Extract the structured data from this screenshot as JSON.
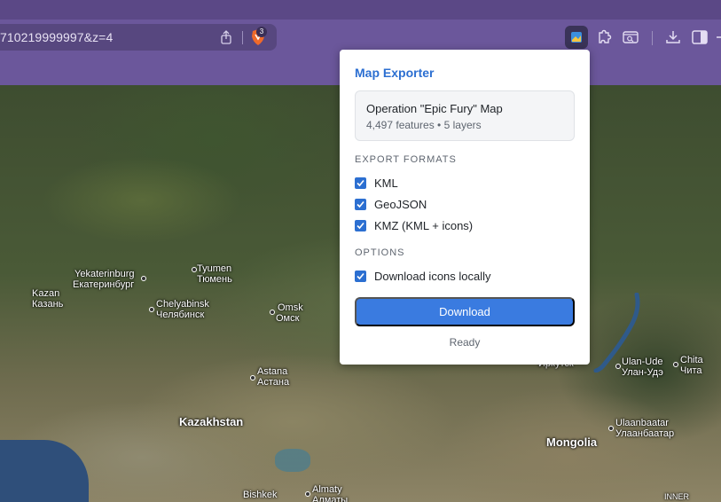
{
  "browser": {
    "url": "710219999997&z=4",
    "brave_badge_count": "3",
    "icons": [
      "share-icon",
      "brave-shields-icon",
      "map-exporter-extension-icon",
      "extensions-puzzle-icon",
      "reader-mode-icon",
      "download-icon",
      "sidebar-toggle-icon"
    ],
    "colors": {
      "tabbar": "#5b4886",
      "toolbar": "#6b579b",
      "urlbar": "#57477f"
    }
  },
  "popup": {
    "title": "Map Exporter",
    "map_name": "Operation \"Epic Fury\" Map",
    "map_stats": "4,497 features • 5 layers",
    "export_formats_label": "EXPORT FORMATS",
    "formats": [
      {
        "label": "KML",
        "checked": true
      },
      {
        "label": "GeoJSON",
        "checked": true
      },
      {
        "label": "KMZ (KML + icons)",
        "checked": true
      }
    ],
    "options_label": "OPTIONS",
    "options": [
      {
        "label": "Download icons locally",
        "checked": true
      }
    ],
    "download_label": "Download",
    "status": "Ready",
    "colors": {
      "accent": "#2c6fd1",
      "button": "#3a7be0"
    }
  },
  "map": {
    "places": {
      "yekaterinburg": "Yekaterinburg",
      "yekaterinburg_ru": "Екатеринбург",
      "kazan": "Kazan",
      "kazan_ru": "Казань",
      "tyumen": "Tyumen",
      "tyumen_ru": "Тюмень",
      "chelyabinsk": "Chelyabinsk",
      "chelyabinsk_ru": "Челябинск",
      "omsk": "Omsk",
      "omsk_ru": "Омск",
      "astana": "Astana",
      "astana_ru": "Астана",
      "kazakhstan": "Kazakhstan",
      "irkutsk_ru": "Иркутск",
      "ulan_ude": "Ulan-Ude",
      "ulan_ude_ru": "Улан-Удэ",
      "chita": "Chita",
      "chita_ru": "Чита",
      "ulaanbaatar": "Ulaanbaatar",
      "ulaanbaatar_ru": "Улаанбаатар",
      "mongolia": "Mongolia",
      "bishkek": "Bishkek",
      "almaty": "Almaty",
      "almaty_ru": "Алматы",
      "inner": "INNER"
    }
  }
}
